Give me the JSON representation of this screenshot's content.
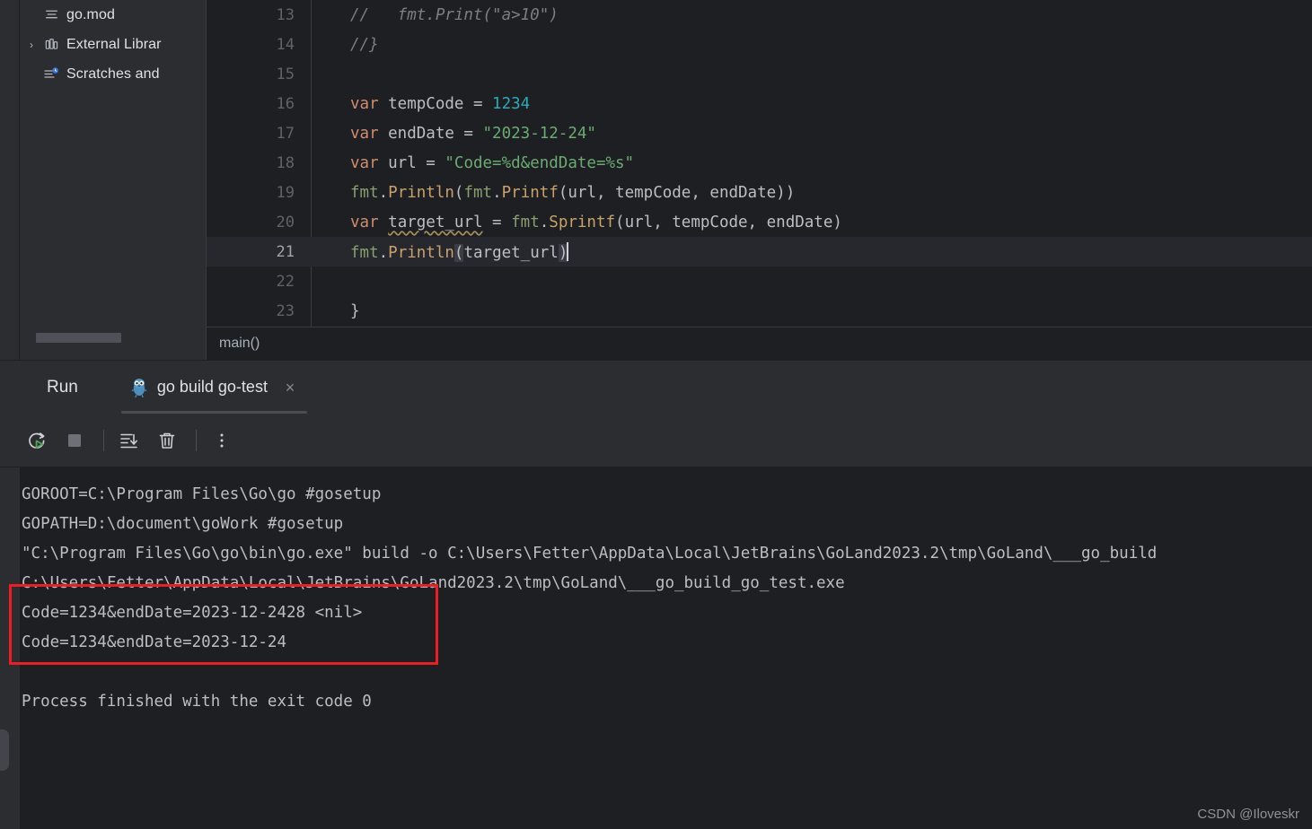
{
  "project_tree": {
    "items": [
      {
        "label": "go.mod",
        "icon": "file-module-icon",
        "has_arrow": false,
        "indent": 1
      },
      {
        "label": "External Librar",
        "icon": "library-icon",
        "has_arrow": true,
        "arrow": "›",
        "indent": 0
      },
      {
        "label": "Scratches and",
        "icon": "scratches-icon",
        "has_arrow": false,
        "indent": 1
      }
    ]
  },
  "editor": {
    "breadcrumb": "main()",
    "current_line": 21,
    "lines": [
      {
        "number": "13",
        "tokens": [
          {
            "t": "//   fmt.Print(\"a>10\")",
            "c": "cmt"
          }
        ]
      },
      {
        "number": "14",
        "tokens": [
          {
            "t": "//}",
            "c": "cmt"
          }
        ]
      },
      {
        "number": "15",
        "tokens": []
      },
      {
        "number": "16",
        "tokens": [
          {
            "t": "var",
            "c": "kw"
          },
          {
            "t": " tempCode = ",
            "c": "pl"
          },
          {
            "t": "1234",
            "c": "num"
          }
        ]
      },
      {
        "number": "17",
        "tokens": [
          {
            "t": "var",
            "c": "kw"
          },
          {
            "t": " endDate = ",
            "c": "pl"
          },
          {
            "t": "\"2023-12-24\"",
            "c": "str"
          }
        ]
      },
      {
        "number": "18",
        "tokens": [
          {
            "t": "var",
            "c": "kw"
          },
          {
            "t": " url = ",
            "c": "pl"
          },
          {
            "t": "\"Code=%d&endDate=%s\"",
            "c": "str"
          }
        ]
      },
      {
        "number": "19",
        "tokens": [
          {
            "t": "fmt",
            "c": "pkg"
          },
          {
            "t": ".",
            "c": "pl"
          },
          {
            "t": "Println",
            "c": "fn"
          },
          {
            "t": "(",
            "c": "pl"
          },
          {
            "t": "fmt",
            "c": "pkg"
          },
          {
            "t": ".",
            "c": "pl"
          },
          {
            "t": "Printf",
            "c": "fn"
          },
          {
            "t": "(url, tempCode, endDate))",
            "c": "pl"
          }
        ]
      },
      {
        "number": "20",
        "tokens": [
          {
            "t": "var",
            "c": "kw"
          },
          {
            "t": " ",
            "c": "pl"
          },
          {
            "t": "target_url",
            "c": "pl warn-underline"
          },
          {
            "t": " = ",
            "c": "pl"
          },
          {
            "t": "fmt",
            "c": "pkg"
          },
          {
            "t": ".",
            "c": "pl"
          },
          {
            "t": "Sprintf",
            "c": "fn"
          },
          {
            "t": "(url, tempCode, endDate)",
            "c": "pl"
          }
        ]
      },
      {
        "number": "21",
        "tokens": [
          {
            "t": "fmt",
            "c": "pkg"
          },
          {
            "t": ".",
            "c": "pl"
          },
          {
            "t": "Println",
            "c": "fn"
          },
          {
            "t": "(",
            "c": "pl brace-hl"
          },
          {
            "t": "target_url",
            "c": "pl"
          },
          {
            "t": ")",
            "c": "pl brace-hl"
          }
        ],
        "caret": true
      },
      {
        "number": "22",
        "tokens": []
      },
      {
        "number": "23",
        "tokens": [
          {
            "t": "}",
            "c": "pl"
          }
        ]
      }
    ]
  },
  "run_panel": {
    "title": "Run",
    "tab_label": "go build go-test",
    "tab_icon": "go-gopher-icon",
    "close_label": "×",
    "toolbar": [
      {
        "name": "rerun-button",
        "icon": "rerun-icon"
      },
      {
        "name": "stop-button",
        "icon": "stop-icon"
      },
      {
        "name": "scroll-to-end-button",
        "icon": "scroll-to-end-icon"
      },
      {
        "name": "clear-all-button",
        "icon": "trash-icon"
      },
      {
        "name": "more-options-button",
        "icon": "more-vertical-icon"
      }
    ],
    "console_lines": [
      "GOROOT=C:\\Program Files\\Go\\go #gosetup",
      "GOPATH=D:\\document\\goWork #gosetup",
      "\"C:\\Program Files\\Go\\go\\bin\\go.exe\" build -o C:\\Users\\Fetter\\AppData\\Local\\JetBrains\\GoLand2023.2\\tmp\\GoLand\\___go_build",
      "C:\\Users\\Fetter\\AppData\\Local\\JetBrains\\GoLand2023.2\\tmp\\GoLand\\___go_build_go_test.exe",
      "Code=1234&endDate=2023-12-2428 <nil>",
      "Code=1234&endDate=2023-12-24",
      "",
      "Process finished with the exit code 0"
    ],
    "highlighted_lines": [
      4,
      5
    ]
  },
  "annotation": {
    "box_color": "#ee1c25",
    "type": "red-rectangle-highlight"
  },
  "watermark": "CSDN @Iloveskr",
  "colors": {
    "background": "#1e1f22",
    "panel": "#2b2d30",
    "keyword": "#cf8e6d",
    "string": "#6aab73",
    "number": "#2aacb8",
    "function": "#c8a26a",
    "package": "#8a9e6f",
    "comment": "#7a7e85",
    "text": "#bcbec4",
    "accent_red": "#ee1c25"
  }
}
